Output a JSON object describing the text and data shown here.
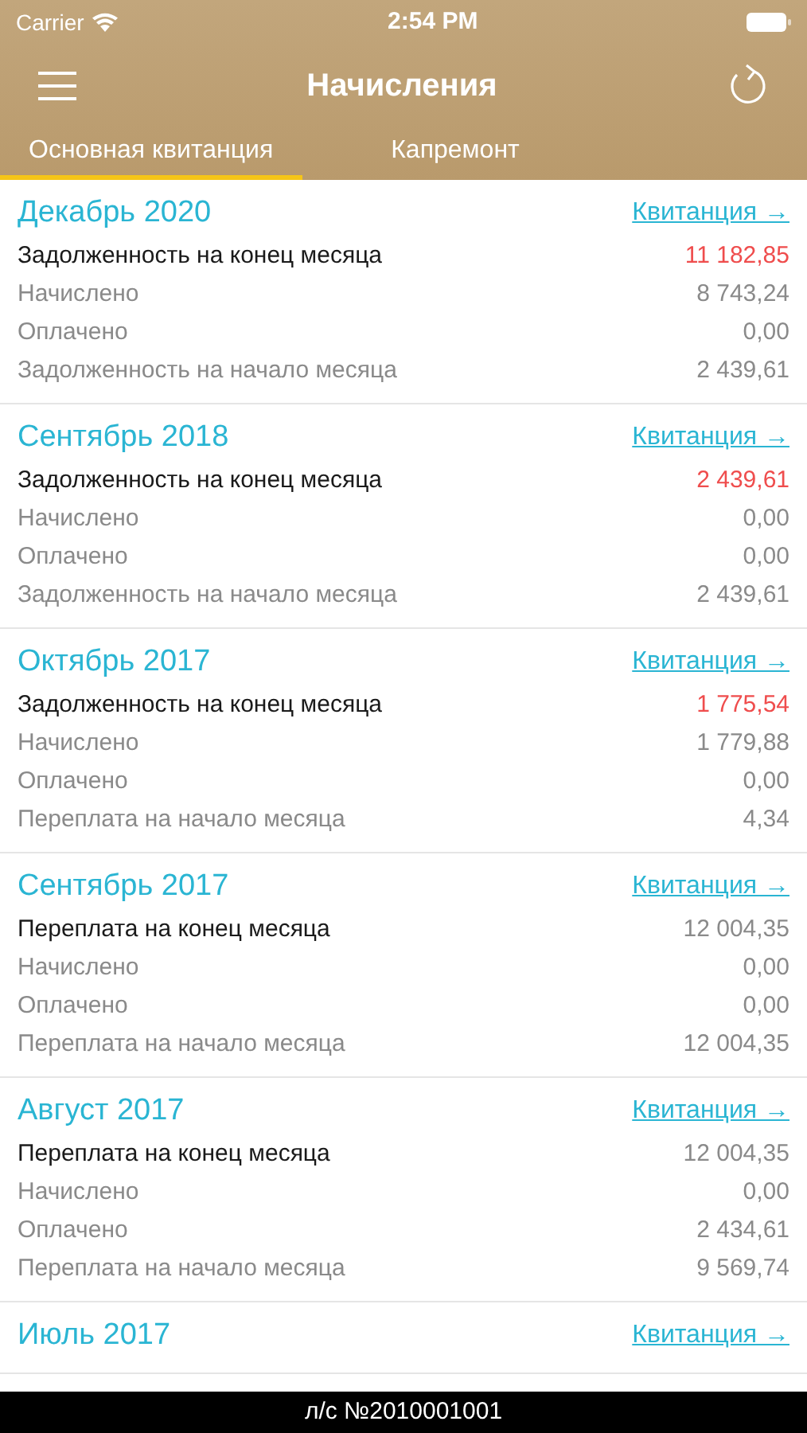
{
  "status_bar": {
    "carrier": "Carrier",
    "time": "2:54 PM"
  },
  "nav": {
    "title": "Начисления"
  },
  "tabs": [
    {
      "label": "Основная квитанция",
      "selected": true
    },
    {
      "label": "Капремонт",
      "selected": false
    }
  ],
  "months": [
    {
      "title": "Декабрь 2020",
      "link": "Квитанция →",
      "rows": [
        {
          "kind": "total",
          "label": "Задолженность на конец месяца",
          "value": "11 182,85",
          "debt": true
        },
        {
          "kind": "detail",
          "label": "Начислено",
          "value": "8 743,24"
        },
        {
          "kind": "detail",
          "label": "Оплачено",
          "value": "0,00"
        },
        {
          "kind": "detail",
          "label": "Задолженность на начало месяца",
          "value": "2 439,61"
        }
      ]
    },
    {
      "title": "Сентябрь 2018",
      "link": "Квитанция →",
      "rows": [
        {
          "kind": "total",
          "label": "Задолженность на конец месяца",
          "value": "2 439,61",
          "debt": true
        },
        {
          "kind": "detail",
          "label": "Начислено",
          "value": "0,00"
        },
        {
          "kind": "detail",
          "label": "Оплачено",
          "value": "0,00"
        },
        {
          "kind": "detail",
          "label": "Задолженность на начало месяца",
          "value": "2 439,61"
        }
      ]
    },
    {
      "title": "Октябрь 2017",
      "link": "Квитанция →",
      "rows": [
        {
          "kind": "total",
          "label": "Задолженность на конец месяца",
          "value": "1 775,54",
          "debt": true
        },
        {
          "kind": "detail",
          "label": "Начислено",
          "value": "1 779,88"
        },
        {
          "kind": "detail",
          "label": "Оплачено",
          "value": "0,00"
        },
        {
          "kind": "detail",
          "label": "Переплата на начало месяца",
          "value": "4,34"
        }
      ]
    },
    {
      "title": "Сентябрь 2017",
      "link": "Квитанция →",
      "rows": [
        {
          "kind": "total",
          "label": "Переплата на конец месяца",
          "value": "12 004,35",
          "debt": false
        },
        {
          "kind": "detail",
          "label": "Начислено",
          "value": "0,00"
        },
        {
          "kind": "detail",
          "label": "Оплачено",
          "value": "0,00"
        },
        {
          "kind": "detail",
          "label": "Переплата на начало месяца",
          "value": "12 004,35"
        }
      ]
    },
    {
      "title": "Август 2017",
      "link": "Квитанция →",
      "rows": [
        {
          "kind": "total",
          "label": "Переплата на конец месяца",
          "value": "12 004,35",
          "debt": false
        },
        {
          "kind": "detail",
          "label": "Начислено",
          "value": "0,00"
        },
        {
          "kind": "detail",
          "label": "Оплачено",
          "value": "2 434,61"
        },
        {
          "kind": "detail",
          "label": "Переплата на начало месяца",
          "value": "9 569,74"
        }
      ]
    },
    {
      "title": "Июль 2017",
      "link": "Квитанция →"
    }
  ],
  "footer": {
    "account": "л/с №2010001001"
  }
}
